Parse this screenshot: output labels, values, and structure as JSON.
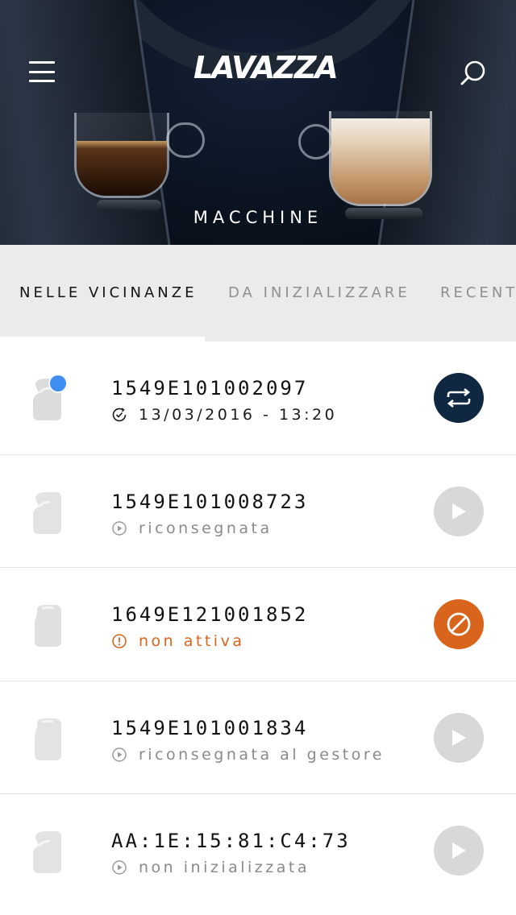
{
  "header": {
    "brand": "LAVAZZA",
    "title": "MACCHINE"
  },
  "tabs": [
    {
      "label": "NELLE VICINANZE",
      "active": true
    },
    {
      "label": "DA INIZIALIZZARE",
      "active": false
    },
    {
      "label": "RECENTI",
      "active": false
    }
  ],
  "machines": [
    {
      "id": "1549E101002097",
      "status": "13/03/2016 - 13:20",
      "status_icon": "clock-check-icon",
      "action": "sync-icon",
      "connected": true
    },
    {
      "id": "1549E101008723",
      "status": "riconsegnata",
      "status_icon": "play-circle-icon",
      "action": "play-icon"
    },
    {
      "id": "1649E121001852",
      "status": "non attiva",
      "status_icon": "alert-circle-icon",
      "action": "blocked-icon"
    },
    {
      "id": "1549E101001834",
      "status": "riconsegnata al gestore",
      "status_icon": "play-circle-icon",
      "action": "play-icon"
    },
    {
      "id": "AA:1E:15:81:C4:73",
      "status": "non inizializzata",
      "status_icon": "play-circle-icon",
      "action": "play-icon"
    }
  ],
  "colors": {
    "header_bg": "#0b1320",
    "tab_bg": "#ebebeb",
    "sync_button": "#0f2741",
    "play_button": "#d8d8d8",
    "warning": "#d9641b",
    "connected_dot": "#3d8ef0"
  }
}
